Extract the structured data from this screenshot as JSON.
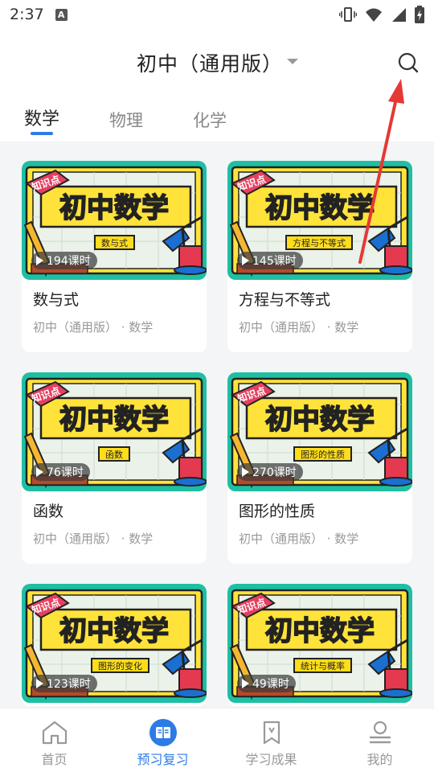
{
  "status_bar": {
    "time": "2:37",
    "notification_letter": "A"
  },
  "header": {
    "title": "初中（通用版）"
  },
  "tabs": [
    {
      "label": "数学",
      "active": true
    },
    {
      "label": "物理",
      "active": false
    },
    {
      "label": "化学",
      "active": false
    }
  ],
  "thumbnail": {
    "badge": "知识点",
    "subject_banner": "初中数学"
  },
  "courses": [
    {
      "title": "数与式",
      "topic": "数与式",
      "lessons": "194课时",
      "meta": "初中（通用版） · 数学"
    },
    {
      "title": "方程与不等式",
      "topic": "方程与不等式",
      "lessons": "145课时",
      "meta": "初中（通用版） · 数学"
    },
    {
      "title": "函数",
      "topic": "函数",
      "lessons": "76课时",
      "meta": "初中（通用版） · 数学"
    },
    {
      "title": "图形的性质",
      "topic": "图形的性质",
      "lessons": "270课时",
      "meta": "初中（通用版） · 数学"
    },
    {
      "title": "",
      "topic": "图形的变化",
      "lessons": "123课时",
      "meta": ""
    },
    {
      "title": "",
      "topic": "统计与概率",
      "lessons": "49课时",
      "meta": ""
    }
  ],
  "bottom_nav": [
    {
      "label": "首页",
      "icon": "home-icon",
      "active": false
    },
    {
      "label": "预习复习",
      "icon": "book-icon",
      "active": true
    },
    {
      "label": "学习成果",
      "icon": "bookmark-icon",
      "active": false
    },
    {
      "label": "我的",
      "icon": "profile-icon",
      "active": false
    }
  ],
  "colors": {
    "accent": "#2d7be5",
    "thumb_teal": "#1fbfa3",
    "thumb_yellow": "#ffdd1a",
    "arrow_red": "#e53935"
  }
}
